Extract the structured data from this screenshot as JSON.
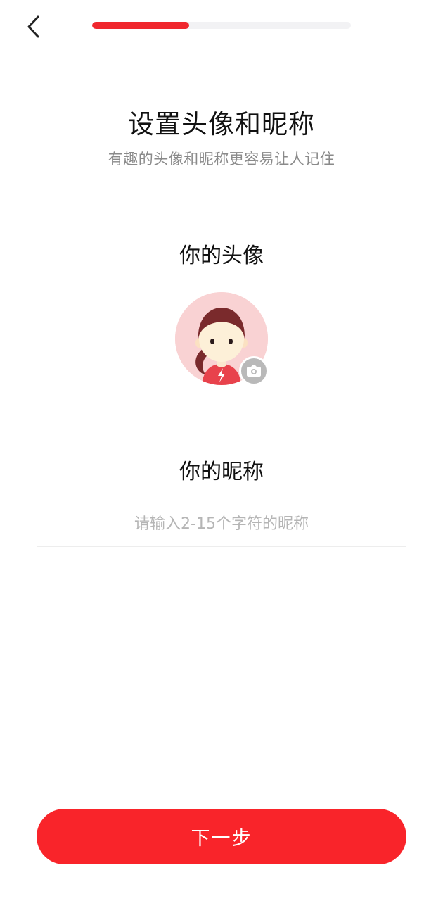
{
  "header": {
    "back_icon": "chevron-left-icon",
    "progress_fraction": 0.375,
    "progress_color": "#f0272e"
  },
  "intro": {
    "title": "设置头像和昵称",
    "subtitle": "有趣的头像和昵称更容易让人记住"
  },
  "avatar_section": {
    "label": "你的头像",
    "avatar_icon": "default-avatar-girl",
    "badge_icon": "camera-icon"
  },
  "nickname_section": {
    "label": "你的昵称",
    "value": "",
    "placeholder": "请输入2-15个字符的昵称"
  },
  "footer": {
    "next_label": "下一步",
    "button_color": "#f9242a"
  }
}
